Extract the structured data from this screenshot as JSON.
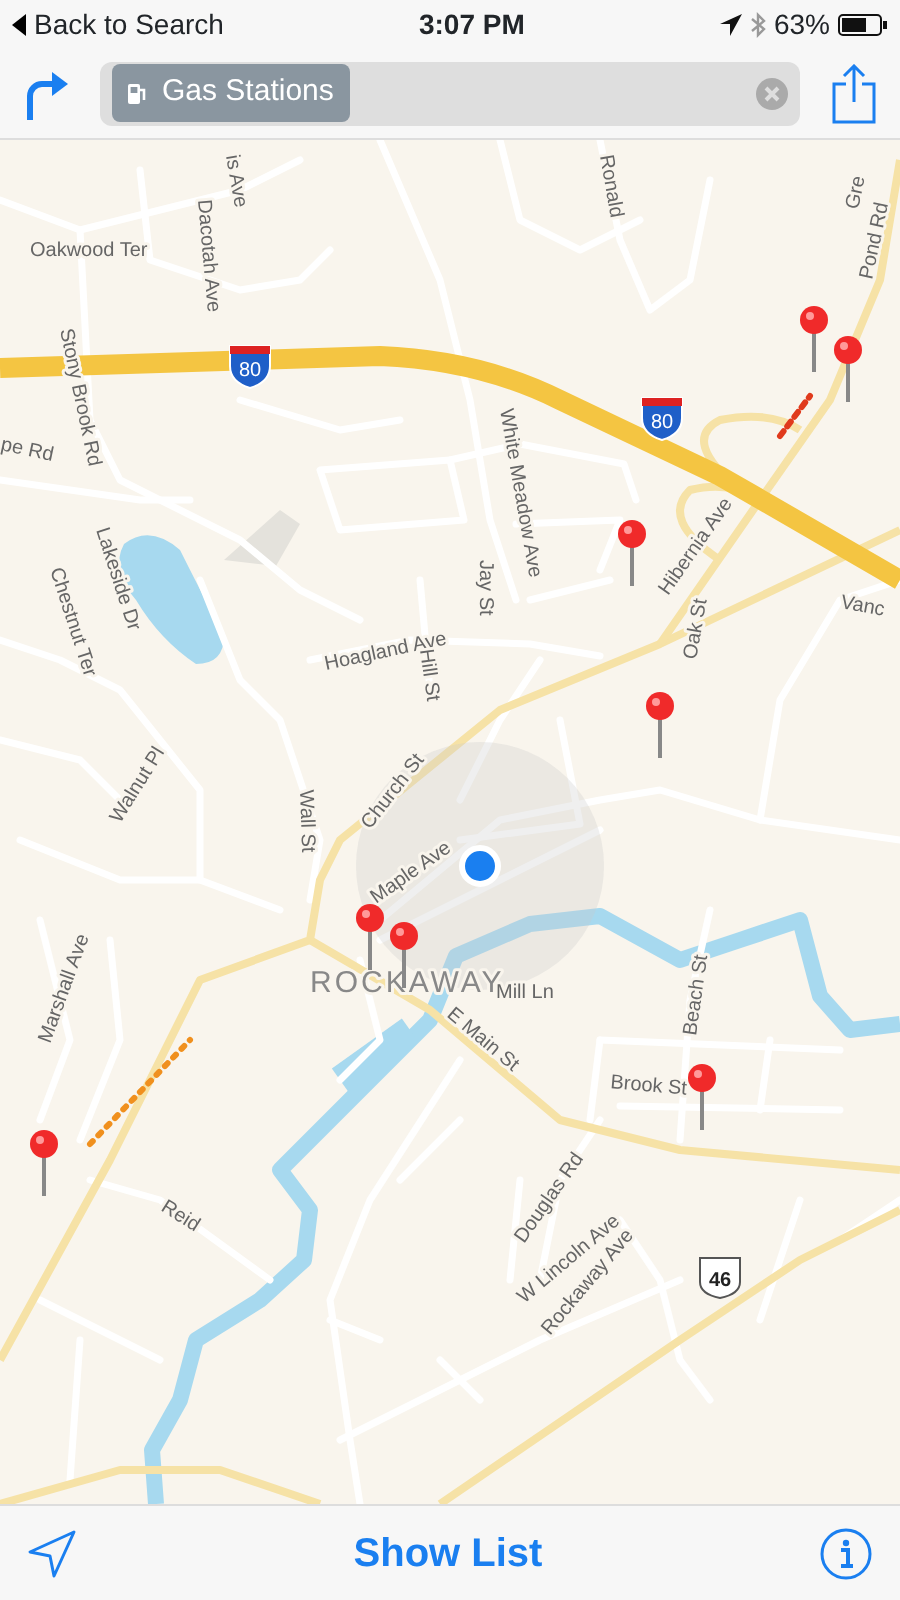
{
  "status_bar": {
    "back_label": "Back to Search",
    "time": "3:07 PM",
    "battery": "63%"
  },
  "search": {
    "token": "Gas Stations"
  },
  "map": {
    "streets": [
      {
        "text": "is Ave"
      },
      {
        "text": "Ronald"
      },
      {
        "text": "Oakwood Ter"
      },
      {
        "text": "Dacotah Ave"
      },
      {
        "text": "Stony Brook Rd"
      },
      {
        "text": "pe Rd"
      },
      {
        "text": "White Meadow Ave"
      },
      {
        "text": "Gre"
      },
      {
        "text": "Pond Rd"
      },
      {
        "text": "Hibernia Ave"
      },
      {
        "text": "Vanc"
      },
      {
        "text": "Jay St"
      },
      {
        "text": "Oak St"
      },
      {
        "text": "Lakeside Dr"
      },
      {
        "text": "Chestnut Ter"
      },
      {
        "text": "Hoagland Ave"
      },
      {
        "text": "Hill St"
      },
      {
        "text": "Walnut Pl"
      },
      {
        "text": "Church St"
      },
      {
        "text": "Wall St"
      },
      {
        "text": "Maple Ave"
      },
      {
        "text": "Mill Ln"
      },
      {
        "text": "E Main St"
      },
      {
        "text": "Marshall Ave"
      },
      {
        "text": "Beach St"
      },
      {
        "text": "Brook St"
      },
      {
        "text": "Reid"
      },
      {
        "text": "Douglas Rd"
      },
      {
        "text": "W Lincoln Ave"
      },
      {
        "text": "Rockaway Ave"
      }
    ],
    "town": "ROCKAWAY",
    "route_shields": [
      {
        "text": "80",
        "kind": "interstate"
      },
      {
        "text": "80",
        "kind": "interstate"
      },
      {
        "text": "46",
        "kind": "us"
      }
    ]
  },
  "bottom_bar": {
    "button": "Show List"
  }
}
